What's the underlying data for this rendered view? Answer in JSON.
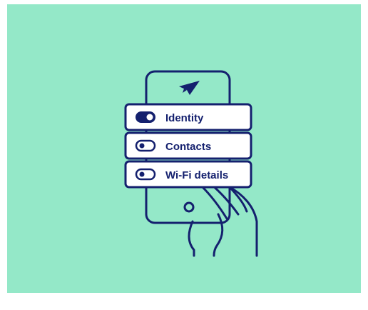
{
  "illustration": {
    "background_color": "#94e8c8",
    "stroke_color": "#14206e",
    "card_fill": "#ffffff",
    "phone_icon": "paper-plane-icon",
    "permissions": [
      {
        "label": "Identity",
        "enabled": true
      },
      {
        "label": "Contacts",
        "enabled": false
      },
      {
        "label": "Wi-Fi details",
        "enabled": false
      }
    ]
  }
}
